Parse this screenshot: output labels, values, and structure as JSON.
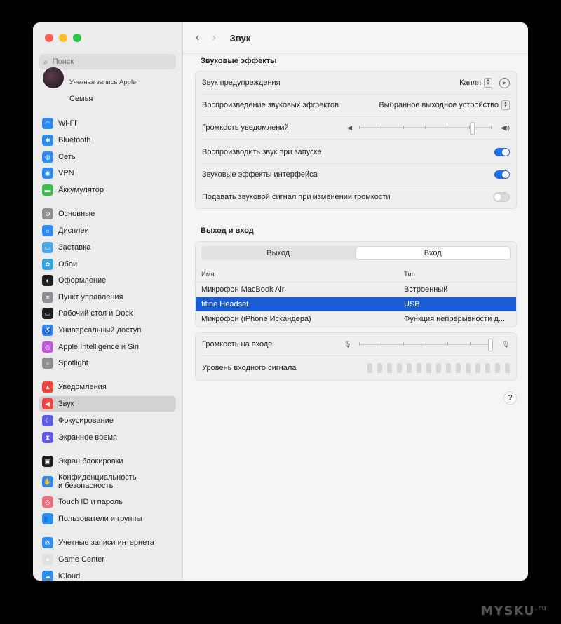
{
  "sidebar": {
    "search_placeholder": "Поиск",
    "apple_account": "Учетная запись Apple",
    "family": "Семья",
    "items": [
      {
        "label": "Wi-Fi",
        "icon": "wifi-icon",
        "color": "#2c8cf5",
        "glyph": "◠"
      },
      {
        "label": "Bluetooth",
        "icon": "bluetooth-icon",
        "color": "#2c8cf5",
        "glyph": "✱"
      },
      {
        "label": "Сеть",
        "icon": "network-icon",
        "color": "#2c8cf5",
        "glyph": "◍"
      },
      {
        "label": "VPN",
        "icon": "vpn-icon",
        "color": "#2c8cf5",
        "glyph": "◉"
      },
      {
        "label": "Аккумулятор",
        "icon": "battery-icon",
        "color": "#3bbf4a",
        "glyph": "▬"
      },
      {
        "label": "Основные",
        "icon": "gear-icon",
        "color": "#8e8e93",
        "glyph": "⚙"
      },
      {
        "label": "Дисплеи",
        "icon": "display-icon",
        "color": "#2c8cf5",
        "glyph": "☼"
      },
      {
        "label": "Заставка",
        "icon": "screensaver-icon",
        "color": "#4aa8e8",
        "glyph": "▭"
      },
      {
        "label": "Обои",
        "icon": "wallpaper-icon",
        "color": "#2ea6e6",
        "glyph": "✿"
      },
      {
        "label": "Оформление",
        "icon": "appearance-icon",
        "color": "#1c1c1e",
        "glyph": "◐"
      },
      {
        "label": "Пункт управления",
        "icon": "control-center-icon",
        "color": "#8e8e93",
        "glyph": "≡"
      },
      {
        "label": "Рабочий стол и Dock",
        "icon": "dock-icon",
        "color": "#1c1c1e",
        "glyph": "▭"
      },
      {
        "label": "Универсальный доступ",
        "icon": "accessibility-icon",
        "color": "#2c8cf5",
        "glyph": "♿"
      },
      {
        "label": "Apple Intelligence и Siri",
        "icon": "siri-icon",
        "color": "#c354e0",
        "glyph": "◎"
      },
      {
        "label": "Spotlight",
        "icon": "spotlight-icon",
        "color": "#8e8e93",
        "glyph": "⌕"
      },
      {
        "label": "Уведомления",
        "icon": "notifications-icon",
        "color": "#f0443a",
        "glyph": "▲"
      },
      {
        "label": "Звук",
        "icon": "sound-icon",
        "color": "#f0443a",
        "glyph": "◀"
      },
      {
        "label": "Фокусирование",
        "icon": "focus-icon",
        "color": "#5e5ce6",
        "glyph": "☾"
      },
      {
        "label": "Экранное время",
        "icon": "screen-time-icon",
        "color": "#5e5ce6",
        "glyph": "⧗"
      },
      {
        "label": "Экран блокировки",
        "icon": "lock-screen-icon",
        "color": "#1c1c1e",
        "glyph": "▣"
      },
      {
        "label": "Конфиденциальность\nи безопасность",
        "icon": "privacy-hand-icon",
        "color": "#2c8cf5",
        "glyph": "✋"
      },
      {
        "label": "Touch ID и пароль",
        "icon": "fingerprint-icon",
        "color": "#f06a78",
        "glyph": "◎"
      },
      {
        "label": "Пользователи и группы",
        "icon": "users-icon",
        "color": "#2c8cf5",
        "glyph": "👥"
      },
      {
        "label": "Учетные записи интернета",
        "icon": "internet-accounts-icon",
        "color": "#2c8cf5",
        "glyph": "@"
      },
      {
        "label": "Game Center",
        "icon": "game-center-icon",
        "color": "#e0e0e0",
        "glyph": "●"
      },
      {
        "label": "iCloud",
        "icon": "icloud-icon",
        "color": "#2c8cf5",
        "glyph": "☁"
      }
    ]
  },
  "header": {
    "title": "Звук"
  },
  "effects": {
    "heading": "Звуковые эффекты",
    "alert_label": "Звук предупреждения",
    "alert_value": "Капля",
    "playback_label": "Воспроизведение звуковых эффектов",
    "playback_value": "Выбранное выходное устройство",
    "notif_volume_label": "Громкость уведомлений",
    "notif_volume_level": 0.85,
    "startup_label": "Воспроизводить звук при запуске",
    "startup_on": true,
    "ui_effects_label": "Звуковые эффекты интерфейса",
    "ui_effects_on": true,
    "feedback_label": "Подавать звуковой сигнал при изменении громкости",
    "feedback_on": false
  },
  "io": {
    "heading": "Выход и вход",
    "tab_output": "Выход",
    "tab_input": "Вход",
    "col_name": "Имя",
    "col_type": "Тип",
    "devices": [
      {
        "name": "Микрофон MacBook Air",
        "type": "Встроенный",
        "selected": false
      },
      {
        "name": "fifine Headset",
        "type": "USB",
        "selected": true
      },
      {
        "name": "Микрофон (iPhone Искандера)",
        "type": "Функция непрерывности д...",
        "selected": false
      }
    ],
    "input_volume_label": "Громкость на входе",
    "input_volume_level": 0.98,
    "input_level_label": "Уровень входного сигнала",
    "input_level_segments": 15,
    "input_level_lit": 0
  },
  "help_label": "?",
  "watermark": {
    "text": "MYSKU",
    "suffix": ".ru"
  },
  "colors": {
    "accent": "#1f6feb",
    "selection": "#1a5bd6"
  }
}
